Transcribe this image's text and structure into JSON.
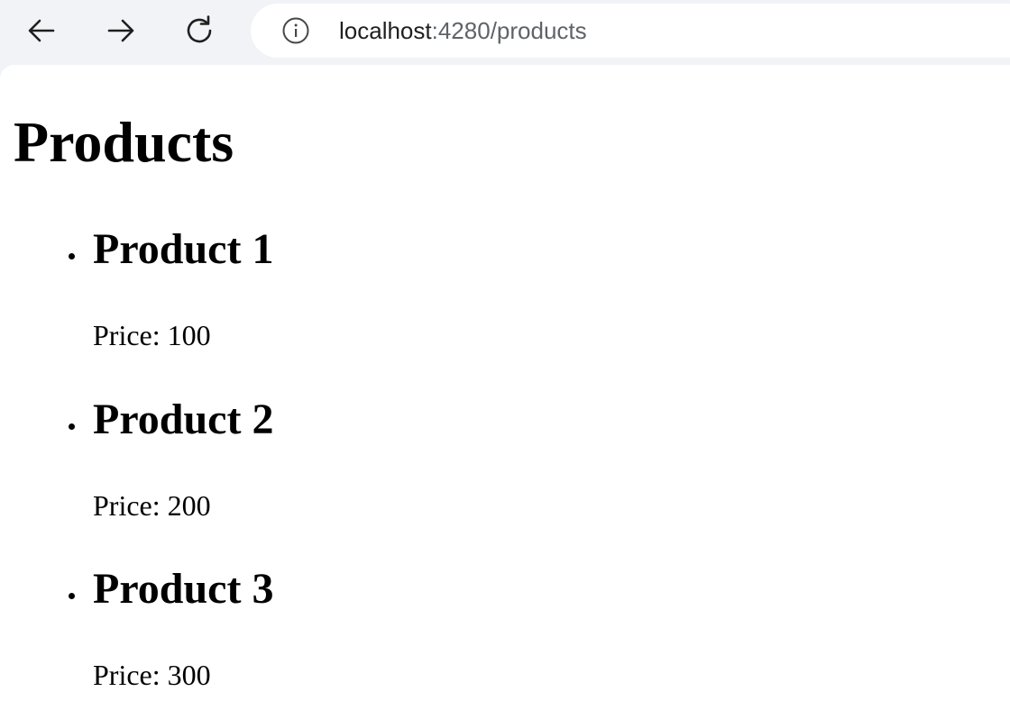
{
  "browser": {
    "url_host": "localhost",
    "url_rest": ":4280/products",
    "icons": {
      "back": "arrow-left-icon",
      "forward": "arrow-right-icon",
      "reload": "reload-icon",
      "site_info": "info-icon"
    }
  },
  "page": {
    "title": "Products",
    "products": [
      {
        "name": "Product 1",
        "price": "Price: 100"
      },
      {
        "name": "Product 2",
        "price": "Price: 200"
      },
      {
        "name": "Product 3",
        "price": "Price: 300"
      }
    ]
  }
}
